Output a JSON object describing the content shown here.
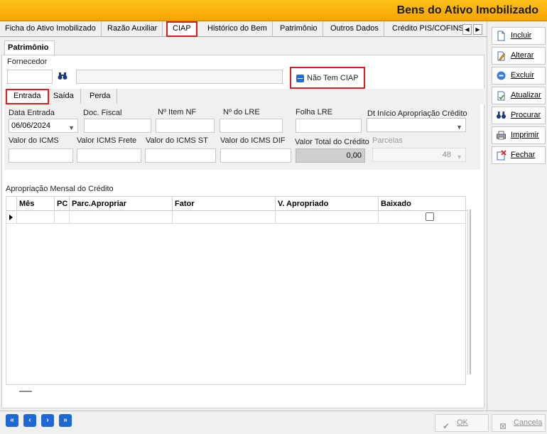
{
  "window": {
    "title": "Bens do Ativo Imobilizado"
  },
  "tabs": [
    {
      "label": "Ficha do Ativo Imobilizado"
    },
    {
      "label": "Razão Auxiliar"
    },
    {
      "label": "CIAP"
    },
    {
      "label": "Histórico do Bem"
    },
    {
      "label": "Patrimônio"
    },
    {
      "label": "Outros Dados"
    },
    {
      "label": "Crédito PIS/COFINS"
    }
  ],
  "subtab": {
    "label": "Patrimônio"
  },
  "fornecedor": {
    "label": "Fornecedor",
    "code": "",
    "name": ""
  },
  "ciap": {
    "label": "Não Tem CIAP"
  },
  "inner_tabs": [
    {
      "label": "Entrada"
    },
    {
      "label": "Saída"
    },
    {
      "label": "Perda"
    }
  ],
  "fields": {
    "data_entrada": {
      "label": "Data Entrada",
      "value": "06/06/2024"
    },
    "doc_fiscal": {
      "label": "Doc. Fiscal",
      "value": ""
    },
    "item_nf": {
      "label": "Nº Item NF",
      "value": ""
    },
    "lre": {
      "label": "Nº do LRE",
      "value": ""
    },
    "folha_lre": {
      "label": "Folha LRE",
      "value": ""
    },
    "dt_inicio": {
      "label": "Dt Início Apropriação Crédito",
      "value": ""
    },
    "valor_icms": {
      "label": "Valor do ICMS",
      "value": ""
    },
    "icms_frete": {
      "label": "Valor ICMS Frete",
      "value": ""
    },
    "icms_st": {
      "label": "Valor do ICMS ST",
      "value": ""
    },
    "icms_dif": {
      "label": "Valor do ICMS DIF",
      "value": ""
    },
    "valor_total": {
      "label": "Valor Total do Crédito",
      "value": "0,00"
    },
    "parcelas": {
      "label": "Parcelas",
      "value": "48"
    }
  },
  "grid": {
    "title": "Apropriação Mensal do Crédito",
    "columns": [
      "Mês",
      "PC",
      "Parc.Apropriar",
      "Fator",
      "V. Apropriado",
      "Baixado"
    ]
  },
  "side_buttons": [
    {
      "label": "Incluir",
      "icon": "document-icon"
    },
    {
      "label": "Alterar",
      "icon": "edit-icon"
    },
    {
      "label": "Excluir",
      "icon": "delete-icon"
    },
    {
      "label": "Atualizar",
      "icon": "refresh-icon"
    },
    {
      "label": "Procurar",
      "icon": "search-icon"
    },
    {
      "label": "Imprimir",
      "icon": "printer-icon"
    },
    {
      "label": "Fechar",
      "icon": "close-icon"
    }
  ],
  "nav_buttons": [
    "first",
    "prev",
    "next",
    "last"
  ],
  "footer": {
    "ok": "OK",
    "cancel": "Cancela"
  },
  "colors": {
    "titlebar": "#f5a300",
    "highlight": "#e11b1b",
    "accent": "#1e68d6"
  }
}
